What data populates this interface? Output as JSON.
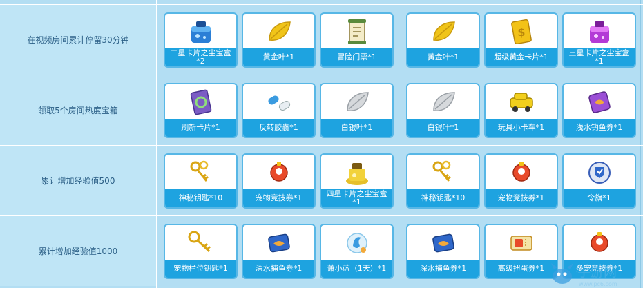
{
  "tasks": [
    {
      "label": "在视频房间累计停留30分钟",
      "rewards": [
        {
          "name": "二星卡片之尘宝盒*2",
          "icon": "blue-dust-box-icon",
          "wrap": true
        },
        {
          "name": "黄金叶*1",
          "icon": "gold-leaf-icon"
        },
        {
          "name": "冒险门票*1",
          "icon": "adventure-ticket-icon"
        },
        {
          "name": "黄金叶*1",
          "icon": "gold-leaf-icon"
        },
        {
          "name": "超级黄金卡片*1",
          "icon": "super-gold-card-icon"
        },
        {
          "name": "三星卡片之尘宝盒*1",
          "icon": "purple-dust-box-icon",
          "wrap": true
        }
      ]
    },
    {
      "label": "领取5个房间热度宝箱",
      "rewards": [
        {
          "name": "刷新卡片*1",
          "icon": "refresh-card-icon"
        },
        {
          "name": "反转胶囊*1",
          "icon": "reverse-capsule-icon"
        },
        {
          "name": "白银叶*1",
          "icon": "silver-leaf-icon"
        },
        {
          "name": "白银叶*1",
          "icon": "silver-leaf-icon"
        },
        {
          "name": "玩具小卡车*1",
          "icon": "toy-truck-icon"
        },
        {
          "name": "浅水钓鱼券*1",
          "icon": "shallow-fishing-ticket-icon"
        }
      ]
    },
    {
      "label": "累计增加经验值500",
      "rewards": [
        {
          "name": "神秘钥匙*10",
          "icon": "mystery-key-icon"
        },
        {
          "name": "宠物竞技券*1",
          "icon": "pet-arena-ticket-icon"
        },
        {
          "name": "四星卡片之尘宝盒*1",
          "icon": "gold-dust-box-icon",
          "wrap": true
        },
        {
          "name": "神秘钥匙*10",
          "icon": "mystery-key-icon"
        },
        {
          "name": "宠物竞技券*1",
          "icon": "pet-arena-ticket-icon"
        },
        {
          "name": "令旗*1",
          "icon": "command-flag-icon"
        }
      ]
    },
    {
      "label": "累计增加经验值1000",
      "rewards": [
        {
          "name": "宠物栏位钥匙*1",
          "icon": "pet-slot-key-icon"
        },
        {
          "name": "深水捕鱼券*1",
          "icon": "deep-fishing-ticket-icon"
        },
        {
          "name": "萧小蓝（1天）*1",
          "icon": "blue-spirit-icon"
        },
        {
          "name": "深水捕鱼券*1",
          "icon": "deep-fishing-ticket-icon"
        },
        {
          "name": "高级扭蛋券*1",
          "icon": "gacha-ticket-icon"
        },
        {
          "name": "多宠竞技券*1",
          "icon": "pet-arena-ticket-icon"
        }
      ]
    }
  ],
  "watermark": {
    "text": "手游网",
    "subtext": "www.pc6.com"
  },
  "colors": {
    "caption_bg": "#1ea3e0",
    "card_border": "#57b7e6",
    "label_text": "#2b5f86",
    "table_bg": "#b3def3"
  }
}
